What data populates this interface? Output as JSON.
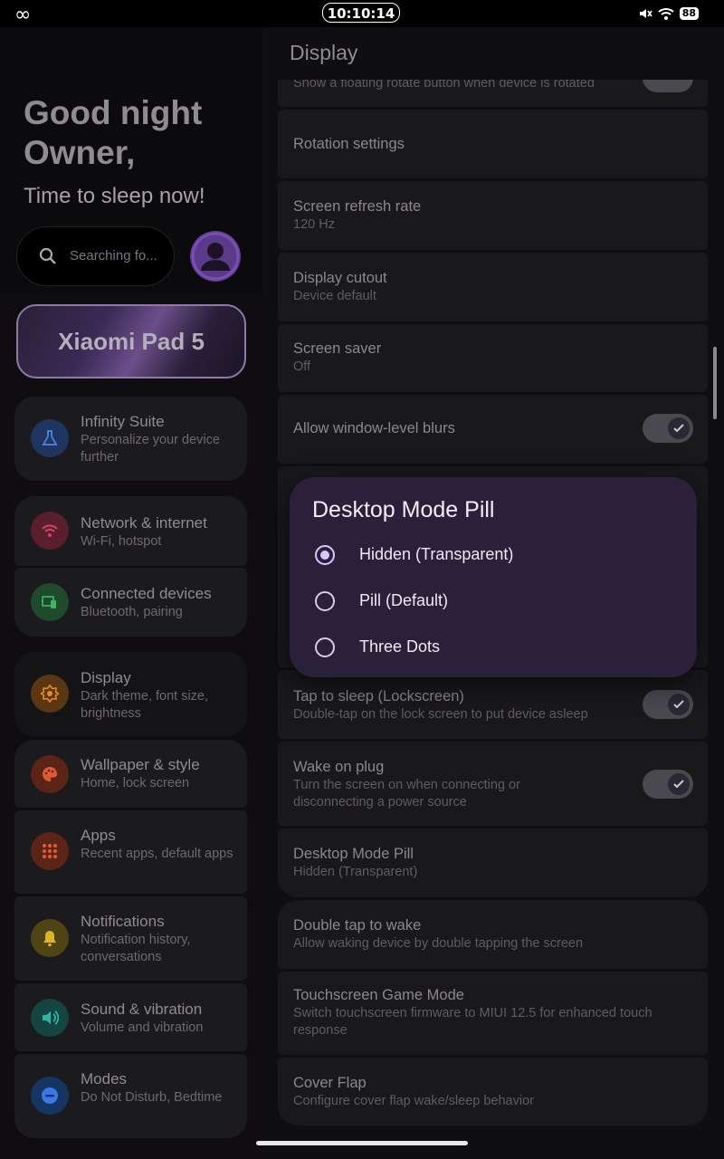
{
  "status_bar": {
    "infinity_glyph": "∞",
    "time": "10:10:14",
    "battery": "88"
  },
  "left": {
    "greeting_line1": "Good night",
    "greeting_line2": "Owner,",
    "greeting_line3": "Time to sleep now!",
    "search_placeholder": "Searching fo...",
    "device_name": "Xiaomi Pad 5",
    "items": [
      {
        "title": "Infinity Suite",
        "subtitle": "Personalize your device further",
        "icon": "flask-icon",
        "color": "#3a6fd0"
      },
      {
        "title": "Network & internet",
        "subtitle": "Wi-Fi, hotspot",
        "icon": "wifi-icon",
        "color": "#c9395c"
      },
      {
        "title": "Connected devices",
        "subtitle": "Bluetooth, pairing",
        "icon": "devices-icon",
        "color": "#3aa856"
      },
      {
        "title": "Display",
        "subtitle": "Dark theme, font size, brightness",
        "icon": "brightness-icon",
        "color": "#e07b1a"
      },
      {
        "title": "Wallpaper & style",
        "subtitle": "Home, lock screen",
        "icon": "palette-icon",
        "color": "#e0502a"
      },
      {
        "title": "Apps",
        "subtitle": "Recent apps, default apps",
        "icon": "apps-grid-icon",
        "color": "#e0502a"
      },
      {
        "title": "Notifications",
        "subtitle": "Notification history, conversations",
        "icon": "bell-icon",
        "color": "#d6b21a"
      },
      {
        "title": "Sound & vibration",
        "subtitle": "Volume and vibration",
        "icon": "speaker-icon",
        "color": "#2aa39a"
      },
      {
        "title": "Modes",
        "subtitle": "Do Not Disturb, Bedtime",
        "icon": "dnd-icon",
        "color": "#2f6fe0"
      }
    ]
  },
  "right": {
    "title": "Display",
    "partial_row_text": "Show a floating rotate button when device is rotated",
    "rows": [
      {
        "title": "Rotation settings",
        "subtitle": ""
      },
      {
        "title": "Screen refresh rate",
        "subtitle": "120 Hz"
      },
      {
        "title": "Display cutout",
        "subtitle": "Device default"
      },
      {
        "title": "Screen saver",
        "subtitle": "Off"
      },
      {
        "title": "Allow window-level blurs",
        "subtitle": "",
        "toggle": true
      },
      {
        "title": "Tap to sleep (Lockscreen)",
        "subtitle": "Double-tap on the lock screen to put device asleep",
        "toggle": true
      },
      {
        "title": "Wake on plug",
        "subtitle": "Turn the screen on when connecting or disconnecting a power source",
        "toggle": true
      },
      {
        "title": "Desktop Mode Pill",
        "subtitle": "Hidden (Transparent)"
      },
      {
        "title": "Double tap to wake",
        "subtitle": "Allow waking device by double tapping the screen"
      },
      {
        "title": "Touchscreen Game Mode",
        "subtitle": "Switch touchscreen firmware to MIUI 12.5 for enhanced touch response"
      },
      {
        "title": "Cover Flap",
        "subtitle": "Configure cover flap wake/sleep behavior"
      }
    ]
  },
  "dialog": {
    "title": "Desktop Mode Pill",
    "options": [
      {
        "label": "Hidden (Transparent)",
        "selected": true
      },
      {
        "label": "Pill (Default)",
        "selected": false
      },
      {
        "label": "Three Dots",
        "selected": false
      }
    ]
  }
}
